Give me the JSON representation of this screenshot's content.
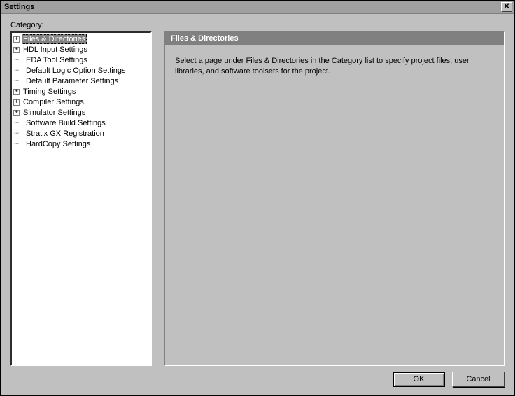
{
  "window": {
    "title": "Settings",
    "close_glyph": "✕"
  },
  "category_label": "Category:",
  "tree": {
    "items": [
      {
        "label": "Files & Directories",
        "expandable": true,
        "selected": true
      },
      {
        "label": "HDL Input Settings",
        "expandable": true,
        "selected": false
      },
      {
        "label": "EDA Tool Settings",
        "expandable": false,
        "selected": false,
        "indent": true
      },
      {
        "label": "Default Logic Option Settings",
        "expandable": false,
        "selected": false,
        "indent": true
      },
      {
        "label": "Default Parameter Settings",
        "expandable": false,
        "selected": false,
        "indent": true
      },
      {
        "label": "Timing Settings",
        "expandable": true,
        "selected": false
      },
      {
        "label": "Compiler Settings",
        "expandable": true,
        "selected": false
      },
      {
        "label": "Simulator Settings",
        "expandable": true,
        "selected": false
      },
      {
        "label": "Software Build Settings",
        "expandable": false,
        "selected": false,
        "indent": true
      },
      {
        "label": "Stratix GX Registration",
        "expandable": false,
        "selected": false,
        "indent": true
      },
      {
        "label": "HardCopy Settings",
        "expandable": false,
        "selected": false,
        "indent": true
      }
    ]
  },
  "right": {
    "header": "Files & Directories",
    "body": "Select a page under Files & Directories in the Category list to specify project files, user libraries, and software toolsets for the project."
  },
  "buttons": {
    "ok": "OK",
    "cancel": "Cancel"
  },
  "glyphs": {
    "plus": "+",
    "dash": "┄"
  }
}
